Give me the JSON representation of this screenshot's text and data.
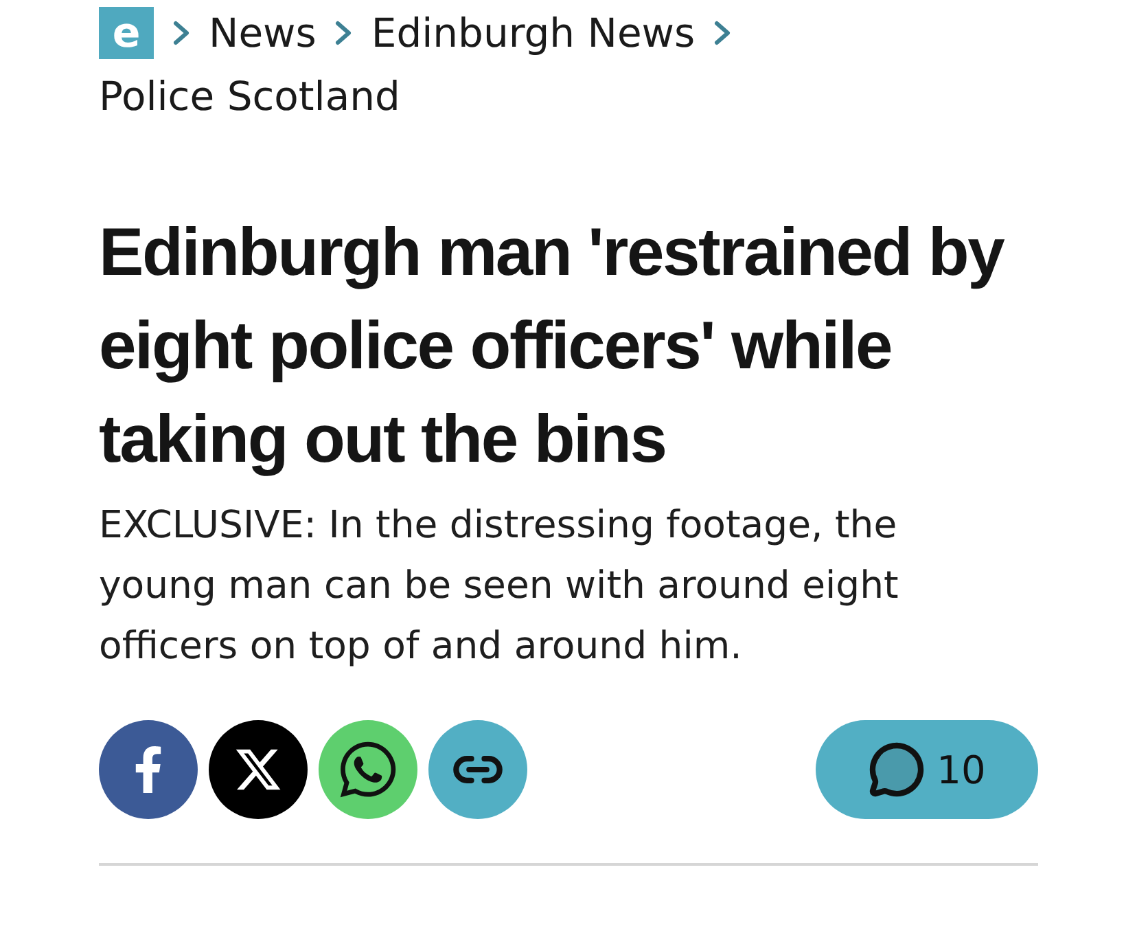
{
  "logo": {
    "letter": "e"
  },
  "breadcrumbs": [
    {
      "label": "News"
    },
    {
      "label": "Edinburgh News"
    },
    {
      "label": "Police Scotland"
    }
  ],
  "headline": "Edinburgh man 'restrained by eight police officers' while taking out the bins",
  "standfirst": "EXCLUSIVE: In the distressing footage, the young man can be seen with around eight officers on top of and around him.",
  "share_buttons": [
    {
      "kind": "facebook"
    },
    {
      "kind": "x"
    },
    {
      "kind": "whatsapp"
    },
    {
      "kind": "link"
    }
  ],
  "comments": {
    "count": "10"
  }
}
